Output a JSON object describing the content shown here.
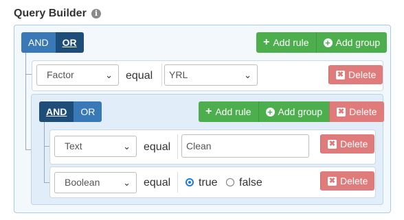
{
  "title": "Query Builder",
  "info_icon": "i",
  "outer": {
    "condition_and": "AND",
    "condition_or": "OR",
    "active_condition": "OR",
    "add_rule": "Add rule",
    "add_group": "Add group",
    "rule": {
      "field": "Factor",
      "operator": "equal",
      "value": "YRL",
      "delete": "Delete"
    }
  },
  "inner": {
    "condition_and": "AND",
    "condition_or": "OR",
    "active_condition": "AND",
    "add_rule": "Add rule",
    "add_group": "Add group",
    "delete": "Delete",
    "rules": [
      {
        "field": "Text",
        "operator": "equal",
        "value": "Clean",
        "delete": "Delete"
      },
      {
        "field": "Boolean",
        "operator": "equal",
        "true_label": "true",
        "false_label": "false",
        "selected": "true",
        "delete": "Delete"
      }
    ]
  },
  "colors": {
    "primary": "#3a79b8",
    "primary_active": "#1f4d7a",
    "success": "#4cae4c",
    "danger": "#e07b7b"
  },
  "icons": [
    "info-icon",
    "plus-icon",
    "plus-circle-icon",
    "x-icon",
    "chevron-down-icon"
  ]
}
